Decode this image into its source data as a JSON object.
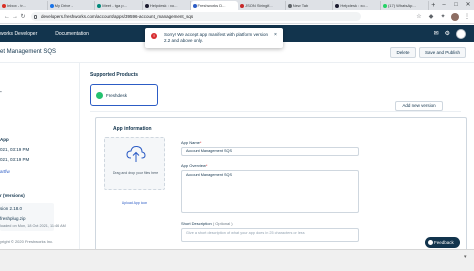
{
  "browser": {
    "tabs": [
      {
        "label": "Inbox - tr...",
        "color": "#d93025"
      },
      {
        "label": "My Drive -",
        "color": "#1a73e8"
      },
      {
        "label": "Meet - tga p...",
        "color": "#00897b"
      },
      {
        "label": "Helpdesk : xo...",
        "color": "#1a1a2e"
      },
      {
        "label": "Freshworks D...",
        "color": "#2c5cc5",
        "active": true
      },
      {
        "label": "JSON Stringif...",
        "color": "#c62828"
      },
      {
        "label": "New Tab",
        "color": "#5f6368"
      },
      {
        "label": "Helpdesk : xo...",
        "color": "#1a1a2e"
      },
      {
        "label": "(17) WhatsAp...",
        "color": "#25d366"
      }
    ],
    "new_tab": "+",
    "url": "developers.freshworks.com/account/apps/39596-account_management_sqs"
  },
  "header": {
    "brand": "works Developer",
    "documentation": "Documentation"
  },
  "titlebar": {
    "title": "et Management SQS",
    "delete_label": "Delete",
    "save_label": "Save and Publish"
  },
  "left_panel": {
    "title": "et Management SQS",
    "app_label": "App",
    "app_date": "021, 03:19 PM",
    "app_date2": "021, 03:19 PM",
    "link": "artfw",
    "versions_heading": "r (Versions)",
    "version": "sion 2.18.0",
    "plugin_name": "freshplug.zip",
    "plugin_date": "loaded on Mon, 18 Oct 2021, 11:46 AM",
    "footer": "yright © 2020 Freshworks Inc."
  },
  "main": {
    "supported_products": "Supported Products",
    "product": "Freshdesk",
    "add_version": "Add new version",
    "section_title": "App information",
    "upload_text": "Drag and drop your files here",
    "upload_link": "Upload App icon",
    "app_name_label": "App Name",
    "app_name_value": "Account Management SQS",
    "app_overview_label": "App Overview",
    "app_overview_value": "Account Management SQS",
    "short_desc_label": "Short Description",
    "short_desc_optional": "( Optional )",
    "short_desc_placeholder": "Give a short description of what your app does in 25 characters or less"
  },
  "toast": {
    "message": "Sorry! We accept app manifest with platform version 2.2 and above only."
  },
  "feedback": {
    "label": "Feedback"
  }
}
